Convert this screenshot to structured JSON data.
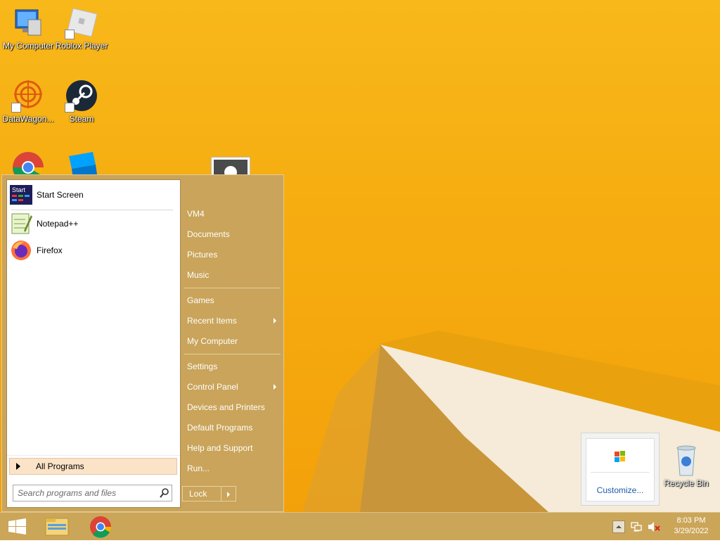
{
  "desktop": {
    "icons": [
      {
        "label": "My Computer"
      },
      {
        "label": "Roblox Player"
      },
      {
        "label": "DataWagon..."
      },
      {
        "label": "Steam"
      },
      {
        "label": "Recycle Bin"
      }
    ]
  },
  "start_menu": {
    "pinned": [
      {
        "label": "Start Screen",
        "icon": "start-screen-icon",
        "icon_text": "Start"
      },
      {
        "label": "Notepad++",
        "icon": "notepad-plus-plus-icon"
      },
      {
        "label": "Firefox",
        "icon": "firefox-icon"
      }
    ],
    "all_programs_label": "All Programs",
    "search_placeholder": "Search programs and files",
    "right_items": [
      {
        "label": "VM4"
      },
      {
        "label": "Documents"
      },
      {
        "label": "Pictures"
      },
      {
        "label": "Music"
      },
      {
        "label": "Games"
      },
      {
        "label": "Recent Items",
        "submenu": true
      },
      {
        "label": "My Computer"
      },
      {
        "label": "Settings"
      },
      {
        "label": "Control Panel",
        "submenu": true
      },
      {
        "label": "Devices and Printers"
      },
      {
        "label": "Default Programs"
      },
      {
        "label": "Help and Support"
      },
      {
        "label": "Run..."
      }
    ],
    "lock_label": "Lock"
  },
  "tray_popup": {
    "customize_label": "Customize..."
  },
  "taskbar": {
    "buttons": [
      "windows-start-icon",
      "file-explorer-icon",
      "chrome-icon"
    ],
    "tray_icons": [
      "show-hidden-icons-icon",
      "network-icon",
      "volume-muted-icon"
    ],
    "clock_time": "8:03 PM",
    "clock_date": "3/29/2022"
  },
  "colors": {
    "accent": "#c9a45a",
    "wallpaper": "#f6ad10",
    "link": "#1e5ba8"
  }
}
